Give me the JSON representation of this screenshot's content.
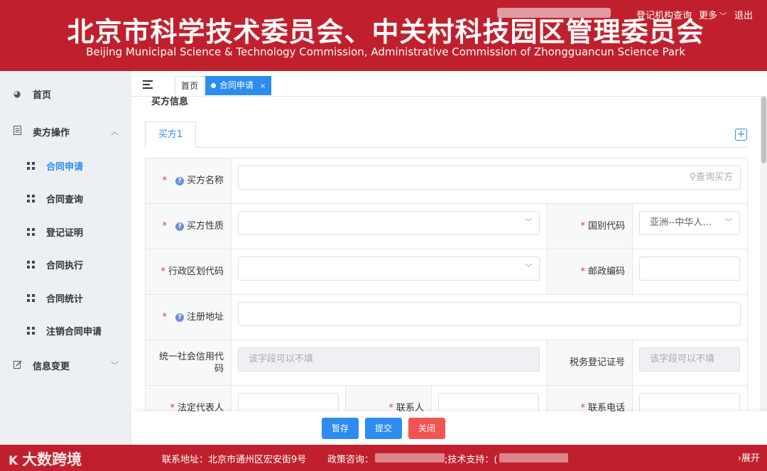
{
  "header": {
    "title_cn": "北京市科学技术委员会、中关村科技园区管理委员会",
    "title_en": "Beijing Municipal Science & Technology Commission, Administrative Commission of Zhongguancun Science Park",
    "link_registry": "登记机构查询",
    "link_more": "更多",
    "link_logout": "退出"
  },
  "sidebar": {
    "home": "首页",
    "seller_ops": "卖方操作",
    "items": [
      "合同申请",
      "合同查询",
      "登记证明",
      "合同执行",
      "合同统计",
      "注销合同申请"
    ],
    "info_change": "信息变更"
  },
  "tabs": {
    "home": "首页",
    "current": "合同申请",
    "close": "×"
  },
  "section": {
    "title": "买方信息",
    "buyer_tab": "买方1",
    "add": "+"
  },
  "form": {
    "buyer_name_label": "买方名称",
    "buyer_name_search": "查询买方",
    "buyer_nature_label": "买方性质",
    "country_code_label": "国别代码",
    "country_code_value": "亚洲--中华人...",
    "admin_code_label": "行政区划代码",
    "postal_code_label": "邮政编码",
    "reg_address_label": "注册地址",
    "credit_code_label": "统一社会信用代码",
    "credit_code_placeholder": "该字段可以不填",
    "tax_no_label": "税务登记证号",
    "tax_no_placeholder": "该字段可以不填",
    "legal_rep_label": "法定代表人",
    "contact_label": "联系人",
    "phone_label": "联系电话"
  },
  "actions": {
    "save": "暂存",
    "submit": "提交",
    "close": "关闭"
  },
  "footer": {
    "logo": "大数跨境",
    "address": "联系地址：北京市通州区宏安街9号",
    "policy": "政策咨询：",
    "tech": ";技术支持：(",
    "expand": "展开"
  },
  "colors": {
    "brand_red": "#c0202d",
    "accent_blue": "#2d8cf0",
    "close_red": "#f05552"
  }
}
